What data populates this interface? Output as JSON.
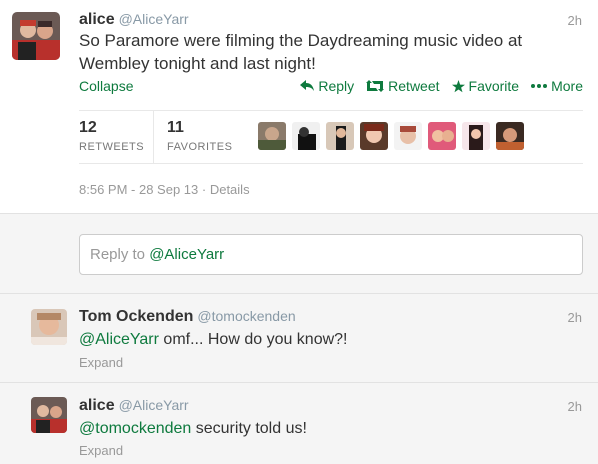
{
  "main_tweet": {
    "name": "alice",
    "handle": "@AliceYarr",
    "time": "2h",
    "text": "So Paramore were filming the Daydreaming music video at Wembley tonight and last night!",
    "collapse_label": "Collapse",
    "actions": {
      "reply": "Reply",
      "retweet": "Retweet",
      "favorite": "Favorite",
      "more": "More"
    },
    "stats": {
      "retweets_count": "12",
      "retweets_label": "RETWEETS",
      "favorites_count": "11",
      "favorites_label": "FAVORITES"
    },
    "timestamp": "8:56 PM - 28 Sep 13",
    "details_label": "Details"
  },
  "reply_box": {
    "prefix": "Reply to ",
    "mention": "@AliceYarr"
  },
  "replies": [
    {
      "name": "Tom Ockenden",
      "handle": "@tomockenden",
      "time": "2h",
      "mention": "@AliceYarr",
      "text": " omf... How do you know?!",
      "expand_label": "Expand"
    },
    {
      "name": "alice",
      "handle": "@AliceYarr",
      "time": "2h",
      "mention": "@tomockenden",
      "text": " security told us!",
      "expand_label": "Expand"
    }
  ],
  "colors": {
    "link_green": "#0e7a3e",
    "muted": "#999999"
  },
  "icons": [
    "reply-icon",
    "retweet-icon",
    "favorite-star-icon",
    "more-dots-icon"
  ]
}
